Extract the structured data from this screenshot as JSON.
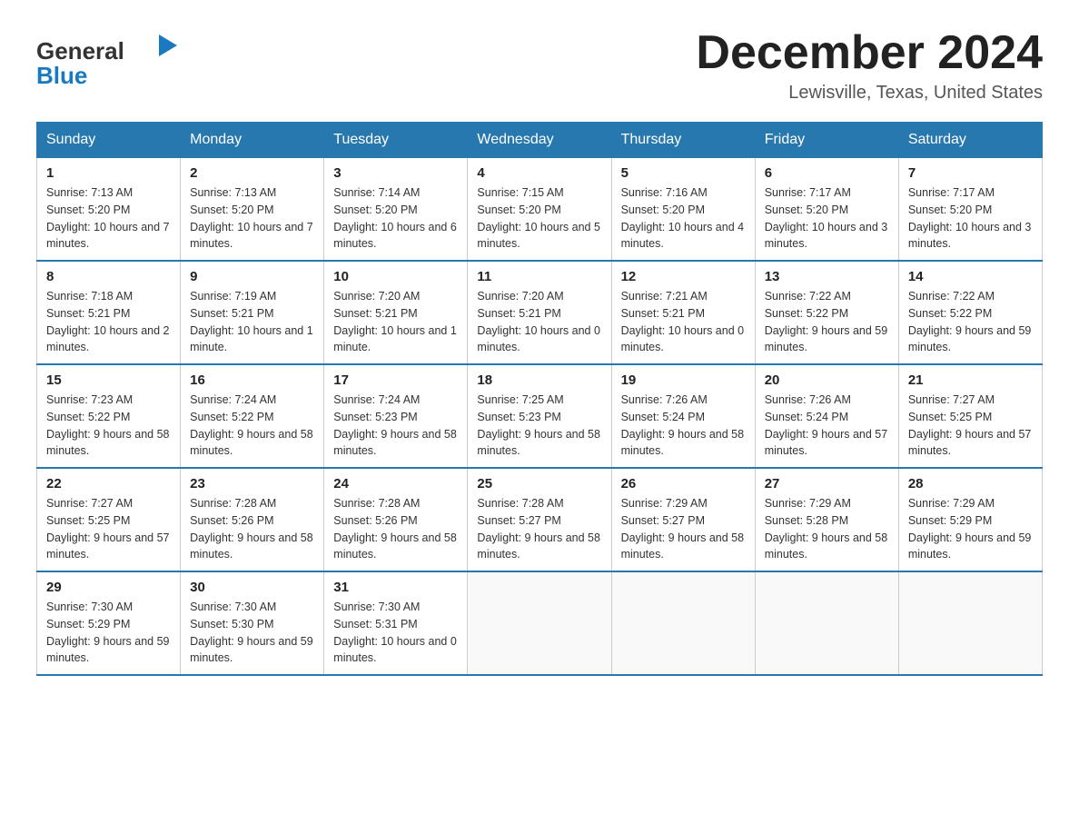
{
  "logo": {
    "general": "General",
    "blue": "Blue"
  },
  "header": {
    "title": "December 2024",
    "location": "Lewisville, Texas, United States"
  },
  "weekdays": [
    "Sunday",
    "Monday",
    "Tuesday",
    "Wednesday",
    "Thursday",
    "Friday",
    "Saturday"
  ],
  "weeks": [
    [
      {
        "day": "1",
        "sunrise": "7:13 AM",
        "sunset": "5:20 PM",
        "daylight": "10 hours and 7 minutes."
      },
      {
        "day": "2",
        "sunrise": "7:13 AM",
        "sunset": "5:20 PM",
        "daylight": "10 hours and 7 minutes."
      },
      {
        "day": "3",
        "sunrise": "7:14 AM",
        "sunset": "5:20 PM",
        "daylight": "10 hours and 6 minutes."
      },
      {
        "day": "4",
        "sunrise": "7:15 AM",
        "sunset": "5:20 PM",
        "daylight": "10 hours and 5 minutes."
      },
      {
        "day": "5",
        "sunrise": "7:16 AM",
        "sunset": "5:20 PM",
        "daylight": "10 hours and 4 minutes."
      },
      {
        "day": "6",
        "sunrise": "7:17 AM",
        "sunset": "5:20 PM",
        "daylight": "10 hours and 3 minutes."
      },
      {
        "day": "7",
        "sunrise": "7:17 AM",
        "sunset": "5:20 PM",
        "daylight": "10 hours and 3 minutes."
      }
    ],
    [
      {
        "day": "8",
        "sunrise": "7:18 AM",
        "sunset": "5:21 PM",
        "daylight": "10 hours and 2 minutes."
      },
      {
        "day": "9",
        "sunrise": "7:19 AM",
        "sunset": "5:21 PM",
        "daylight": "10 hours and 1 minute."
      },
      {
        "day": "10",
        "sunrise": "7:20 AM",
        "sunset": "5:21 PM",
        "daylight": "10 hours and 1 minute."
      },
      {
        "day": "11",
        "sunrise": "7:20 AM",
        "sunset": "5:21 PM",
        "daylight": "10 hours and 0 minutes."
      },
      {
        "day": "12",
        "sunrise": "7:21 AM",
        "sunset": "5:21 PM",
        "daylight": "10 hours and 0 minutes."
      },
      {
        "day": "13",
        "sunrise": "7:22 AM",
        "sunset": "5:22 PM",
        "daylight": "9 hours and 59 minutes."
      },
      {
        "day": "14",
        "sunrise": "7:22 AM",
        "sunset": "5:22 PM",
        "daylight": "9 hours and 59 minutes."
      }
    ],
    [
      {
        "day": "15",
        "sunrise": "7:23 AM",
        "sunset": "5:22 PM",
        "daylight": "9 hours and 58 minutes."
      },
      {
        "day": "16",
        "sunrise": "7:24 AM",
        "sunset": "5:22 PM",
        "daylight": "9 hours and 58 minutes."
      },
      {
        "day": "17",
        "sunrise": "7:24 AM",
        "sunset": "5:23 PM",
        "daylight": "9 hours and 58 minutes."
      },
      {
        "day": "18",
        "sunrise": "7:25 AM",
        "sunset": "5:23 PM",
        "daylight": "9 hours and 58 minutes."
      },
      {
        "day": "19",
        "sunrise": "7:26 AM",
        "sunset": "5:24 PM",
        "daylight": "9 hours and 58 minutes."
      },
      {
        "day": "20",
        "sunrise": "7:26 AM",
        "sunset": "5:24 PM",
        "daylight": "9 hours and 57 minutes."
      },
      {
        "day": "21",
        "sunrise": "7:27 AM",
        "sunset": "5:25 PM",
        "daylight": "9 hours and 57 minutes."
      }
    ],
    [
      {
        "day": "22",
        "sunrise": "7:27 AM",
        "sunset": "5:25 PM",
        "daylight": "9 hours and 57 minutes."
      },
      {
        "day": "23",
        "sunrise": "7:28 AM",
        "sunset": "5:26 PM",
        "daylight": "9 hours and 58 minutes."
      },
      {
        "day": "24",
        "sunrise": "7:28 AM",
        "sunset": "5:26 PM",
        "daylight": "9 hours and 58 minutes."
      },
      {
        "day": "25",
        "sunrise": "7:28 AM",
        "sunset": "5:27 PM",
        "daylight": "9 hours and 58 minutes."
      },
      {
        "day": "26",
        "sunrise": "7:29 AM",
        "sunset": "5:27 PM",
        "daylight": "9 hours and 58 minutes."
      },
      {
        "day": "27",
        "sunrise": "7:29 AM",
        "sunset": "5:28 PM",
        "daylight": "9 hours and 58 minutes."
      },
      {
        "day": "28",
        "sunrise": "7:29 AM",
        "sunset": "5:29 PM",
        "daylight": "9 hours and 59 minutes."
      }
    ],
    [
      {
        "day": "29",
        "sunrise": "7:30 AM",
        "sunset": "5:29 PM",
        "daylight": "9 hours and 59 minutes."
      },
      {
        "day": "30",
        "sunrise": "7:30 AM",
        "sunset": "5:30 PM",
        "daylight": "9 hours and 59 minutes."
      },
      {
        "day": "31",
        "sunrise": "7:30 AM",
        "sunset": "5:31 PM",
        "daylight": "10 hours and 0 minutes."
      },
      null,
      null,
      null,
      null
    ]
  ]
}
